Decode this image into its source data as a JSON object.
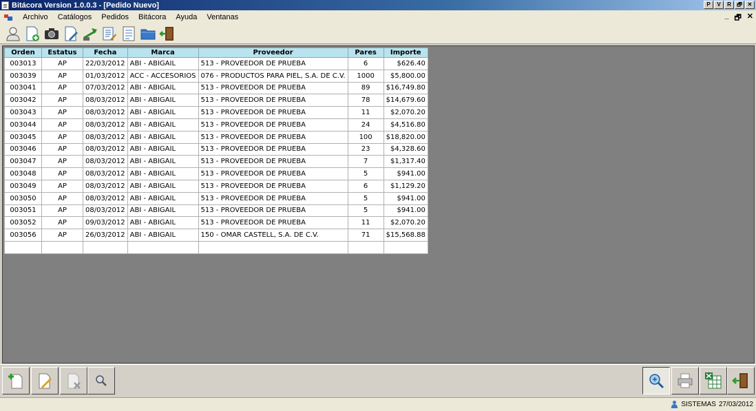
{
  "window": {
    "title": "Bitácora Version 1.0.0.3 - [Pedido Nuevo]",
    "title_buttons": [
      "P",
      "V",
      "R",
      "🗗",
      "✕"
    ]
  },
  "menu": {
    "items": [
      "Archivo",
      "Catálogos",
      "Pedidos",
      "Bitácora",
      "Ayuda",
      "Ventanas"
    ],
    "mdi_controls": [
      "_",
      "🗗",
      "✕"
    ]
  },
  "toolbar": {
    "icons": [
      "user-icon",
      "new-document-icon",
      "camera-icon",
      "document-edit-icon",
      "export-icon",
      "list-document-icon",
      "report-icon",
      "folder-icon",
      "exit-door-icon"
    ]
  },
  "grid": {
    "columns": [
      "Orden",
      "Estatus",
      "Fecha",
      "Marca",
      "Proveedor",
      "Pares",
      "Importe"
    ],
    "rows": [
      [
        "003013",
        "AP",
        "22/03/2012",
        "ABI - ABIGAIL",
        "513 - PROVEEDOR DE PRUEBA",
        "6",
        "$626.40"
      ],
      [
        "003039",
        "AP",
        "01/03/2012",
        "ACC - ACCESORIOS",
        "076 - PRODUCTOS PARA PIEL, S.A. DE C.V.",
        "1000",
        "$5,800.00"
      ],
      [
        "003041",
        "AP",
        "07/03/2012",
        "ABI - ABIGAIL",
        "513 - PROVEEDOR DE PRUEBA",
        "89",
        "$16,749.80"
      ],
      [
        "003042",
        "AP",
        "08/03/2012",
        "ABI - ABIGAIL",
        "513 - PROVEEDOR DE PRUEBA",
        "78",
        "$14,679.60"
      ],
      [
        "003043",
        "AP",
        "08/03/2012",
        "ABI - ABIGAIL",
        "513 - PROVEEDOR DE PRUEBA",
        "11",
        "$2,070.20"
      ],
      [
        "003044",
        "AP",
        "08/03/2012",
        "ABI - ABIGAIL",
        "513 - PROVEEDOR DE PRUEBA",
        "24",
        "$4,516.80"
      ],
      [
        "003045",
        "AP",
        "08/03/2012",
        "ABI - ABIGAIL",
        "513 - PROVEEDOR DE PRUEBA",
        "100",
        "$18,820.00"
      ],
      [
        "003046",
        "AP",
        "08/03/2012",
        "ABI - ABIGAIL",
        "513 - PROVEEDOR DE PRUEBA",
        "23",
        "$4,328.60"
      ],
      [
        "003047",
        "AP",
        "08/03/2012",
        "ABI - ABIGAIL",
        "513 - PROVEEDOR DE PRUEBA",
        "7",
        "$1,317.40"
      ],
      [
        "003048",
        "AP",
        "08/03/2012",
        "ABI - ABIGAIL",
        "513 - PROVEEDOR DE PRUEBA",
        "5",
        "$941.00"
      ],
      [
        "003049",
        "AP",
        "08/03/2012",
        "ABI - ABIGAIL",
        "513 - PROVEEDOR DE PRUEBA",
        "6",
        "$1,129.20"
      ],
      [
        "003050",
        "AP",
        "08/03/2012",
        "ABI - ABIGAIL",
        "513 - PROVEEDOR DE PRUEBA",
        "5",
        "$941.00"
      ],
      [
        "003051",
        "AP",
        "08/03/2012",
        "ABI - ABIGAIL",
        "513 - PROVEEDOR DE PRUEBA",
        "5",
        "$941.00"
      ],
      [
        "003052",
        "AP",
        "09/03/2012",
        "ABI - ABIGAIL",
        "513 - PROVEEDOR DE PRUEBA",
        "11",
        "$2,070.20"
      ],
      [
        "003056",
        "AP",
        "26/03/2012",
        "ABI - ABIGAIL",
        "150 - OMAR CASTELL, S.A. DE C.V.",
        "71",
        "$15,568.88"
      ],
      [
        "",
        "",
        "",
        "",
        "",
        "",
        ""
      ]
    ]
  },
  "bottom_buttons": {
    "left": [
      "add-document-icon",
      "edit-document-icon",
      "delete-document-icon",
      "search-icon"
    ],
    "right": [
      "zoom-icon",
      "print-icon",
      "excel-icon",
      "exit-door-icon"
    ]
  },
  "status": {
    "user": "SISTEMAS",
    "date": "27/03/2012"
  },
  "colors": {
    "header_bg": "#b9e3ee",
    "workspace_bg": "#808080",
    "title_gradient_start": "#0a246a"
  }
}
